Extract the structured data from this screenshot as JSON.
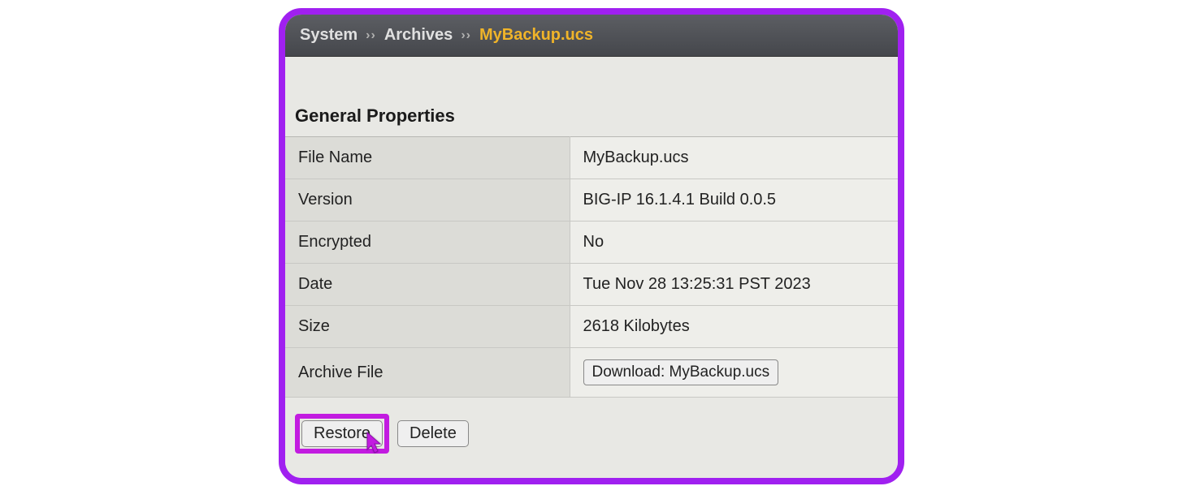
{
  "breadcrumb": {
    "crumb1": "System",
    "sep": "››",
    "crumb2": "Archives",
    "current": "MyBackup.ucs"
  },
  "section": {
    "title": "General Properties"
  },
  "properties": {
    "filename_label": "File Name",
    "filename_value": "MyBackup.ucs",
    "version_label": "Version",
    "version_value": "BIG-IP 16.1.4.1 Build 0.0.5",
    "encrypted_label": "Encrypted",
    "encrypted_value": "No",
    "date_label": "Date",
    "date_value": "Tue Nov 28 13:25:31 PST 2023",
    "size_label": "Size",
    "size_value": "2618 Kilobytes",
    "archive_label": "Archive File",
    "archive_download": "Download: MyBackup.ucs"
  },
  "actions": {
    "restore": "Restore",
    "delete": "Delete"
  }
}
